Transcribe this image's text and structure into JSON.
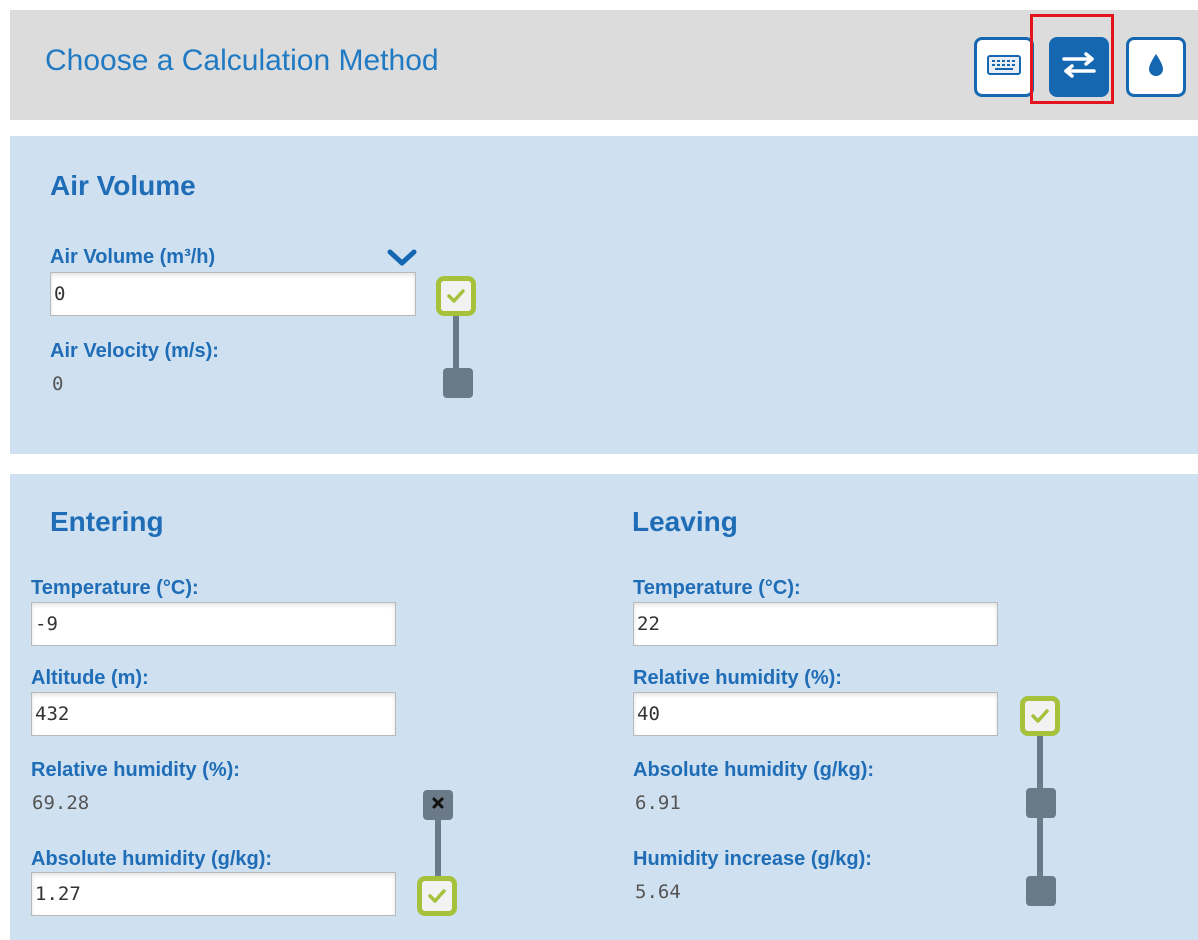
{
  "header": {
    "title": "Choose a Calculation Method",
    "tools": [
      {
        "name": "keyboard",
        "icon": "keyboard-icon"
      },
      {
        "name": "swap",
        "icon": "swap-arrows-icon",
        "active": true
      },
      {
        "name": "humidity",
        "icon": "water-drop-icon"
      }
    ]
  },
  "air_volume": {
    "title": "Air Volume",
    "volume_label": "Air Volume (m³/h)",
    "volume_value": "0",
    "velocity_label": "Air Velocity (m/s):",
    "velocity_value": "0"
  },
  "entering": {
    "title": "Entering",
    "temp_label": "Temperature (°C):",
    "temp_value": "-9",
    "altitude_label": "Altitude (m):",
    "altitude_value": "432",
    "rh_label": "Relative humidity (%):",
    "rh_value": "69.28",
    "ah_label": "Absolute humidity (g/kg):",
    "ah_value": "1.27"
  },
  "leaving": {
    "title": "Leaving",
    "temp_label": "Temperature (°C):",
    "temp_value": "22",
    "rh_label": "Relative humidity (%):",
    "rh_value": "40",
    "ah_label": "Absolute humidity (g/kg):",
    "ah_value": "6.91",
    "increase_label": "Humidity increase (g/kg):",
    "increase_value": "5.64"
  },
  "colors": {
    "accent": "#1f6db6",
    "panel_bg": "#cfe0f1",
    "header_bg": "#dcdcdc",
    "check_green": "#a6c23c",
    "lock_gray": "#6a7a89",
    "highlight_red": "#e4141e"
  }
}
